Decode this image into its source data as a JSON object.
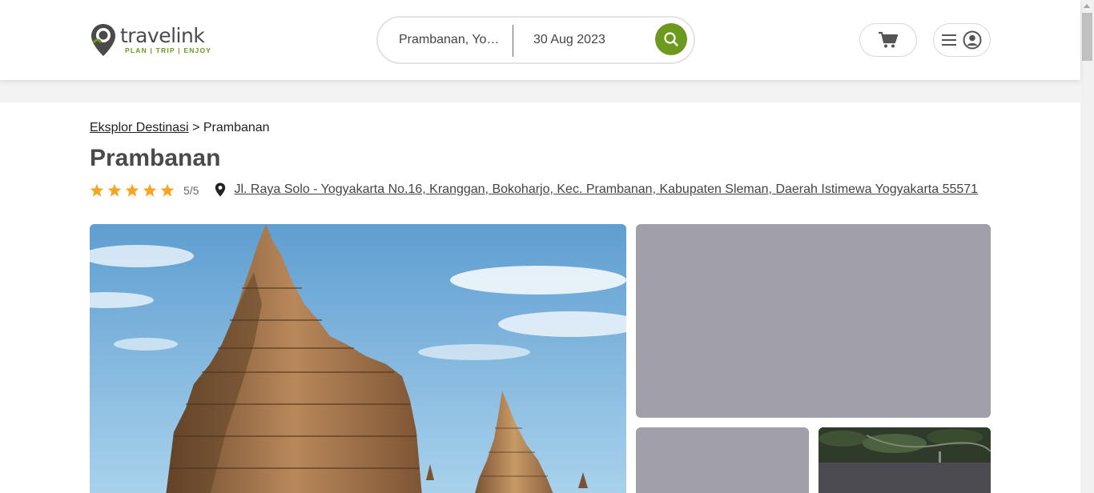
{
  "brand": {
    "name": "travelink",
    "tagline": "PLAN | TRIP | ENJOY",
    "accent_color": "#6c9a1e",
    "text_color": "#4a4a4a"
  },
  "search": {
    "destination": "Prambanan, Yogyakarta",
    "date": "30 Aug 2023",
    "button_icon": "search-icon"
  },
  "nav": {
    "cart_icon": "cart-icon",
    "menu_icon": "hamburger-icon",
    "account_icon": "user-circle-icon"
  },
  "breadcrumb": {
    "parent": "Eksplor Destinasi",
    "separator": ">",
    "current": "Prambanan"
  },
  "destination": {
    "title": "Prambanan",
    "rating": 5,
    "rating_label": "5/5",
    "star_color": "#f5a623",
    "address": "Jl. Raya Solo - Yogyakarta No.16, Kranggan, Bokoharjo, Kec. Prambanan, Kabupaten Sleman, Daerah Istimewa Yogyakarta 55571"
  },
  "gallery": {
    "main_photo": "prambanan-temple-photo",
    "side_photos": [
      "placeholder-photo",
      "placeholder-photo",
      "aerial-park-photo"
    ]
  }
}
